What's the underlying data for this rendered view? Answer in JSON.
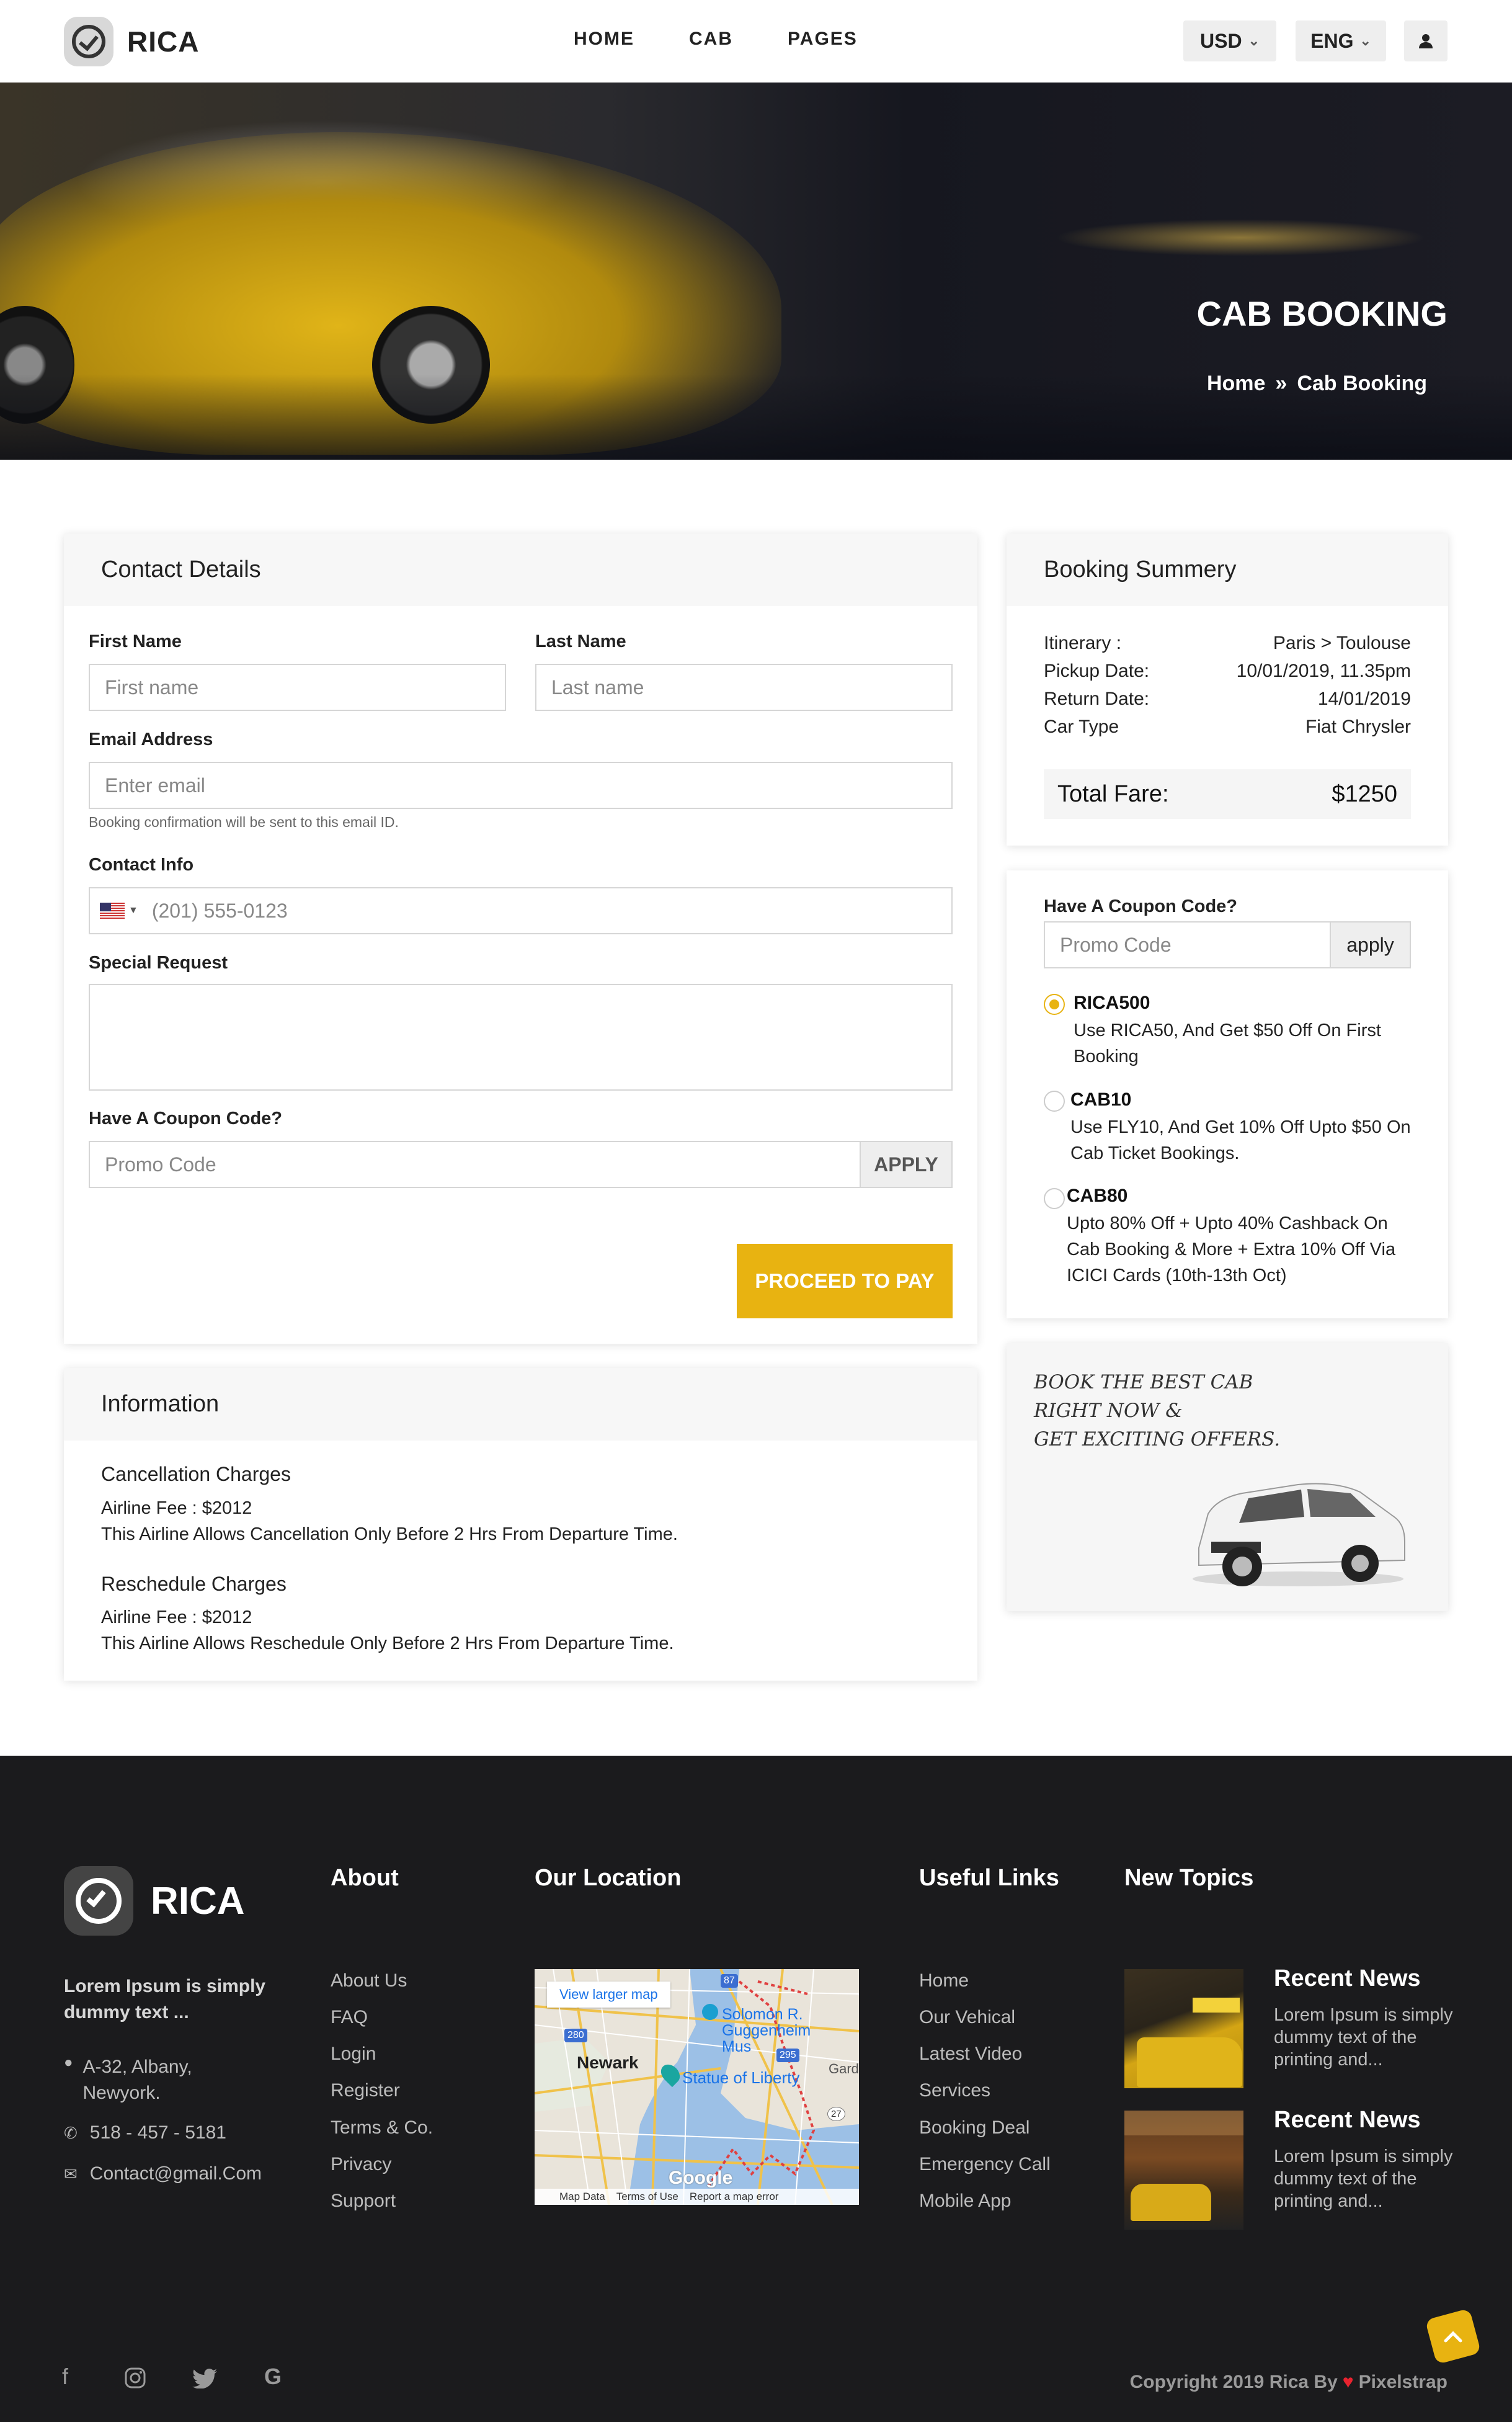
{
  "header": {
    "brand": "RICA",
    "nav": [
      "HOME",
      "CAB",
      "PAGES"
    ],
    "currency": "USD",
    "language": "ENG"
  },
  "hero": {
    "title": "CAB BOOKING",
    "breadcrumb_home": "Home",
    "breadcrumb_sep": "»",
    "breadcrumb_current": "Cab Booking"
  },
  "contact": {
    "title": "Contact Details",
    "first_name_label": "First Name",
    "first_name_placeholder": "First name",
    "last_name_label": "Last Name",
    "last_name_placeholder": "Last name",
    "email_label": "Email Address",
    "email_placeholder": "Enter email",
    "email_hint": "Booking confirmation will be sent to this email ID.",
    "contact_info_label": "Contact Info",
    "phone_placeholder": "(201) 555-0123",
    "special_request_label": "Special Request",
    "coupon_label": "Have A Coupon Code?",
    "coupon_placeholder": "Promo Code",
    "apply_label": "APPLY",
    "proceed_label": "PROCEED TO PAY"
  },
  "summary": {
    "title": "Booking Summery",
    "rows": [
      {
        "label": "Itinerary :",
        "value": "Paris > Toulouse"
      },
      {
        "label": "Pickup Date:",
        "value": "10/01/2019, 11.35pm"
      },
      {
        "label": "Return Date:",
        "value": "14/01/2019"
      },
      {
        "label": "Car Type",
        "value": "Fiat Chrysler"
      }
    ],
    "total_label": "Total Fare:",
    "total_value": "$1250"
  },
  "coupon_box": {
    "label": "Have A Coupon Code?",
    "placeholder": "Promo Code",
    "apply": "apply",
    "options": [
      {
        "code": "RICA500",
        "desc": "Use RICA50, And Get $50 Off On First Booking",
        "selected": true
      },
      {
        "code": "CAB10",
        "desc": "Use FLY10, And Get 10% Off Upto $50 On Cab Ticket Bookings.",
        "selected": false
      },
      {
        "code": "CAB80",
        "desc": "Upto 80% Off + Upto 40% Cashback On Cab Booking & More + Extra 10% Off Via ICICI Cards (10th-13th Oct)",
        "selected": false
      }
    ]
  },
  "promo": {
    "line1": "BOOK THE BEST CAB",
    "line2": "RIGHT NOW  &",
    "line3": "GET EXCITING OFFERS."
  },
  "information": {
    "title": "Information",
    "cancel_title": "Cancellation Charges",
    "cancel_fee": "Airline Fee : $2012",
    "cancel_text": "This Airline Allows Cancellation Only Before 2 Hrs From Departure Time.",
    "resched_title": "Reschedule Charges",
    "resched_fee": "Airline Fee : $2012",
    "resched_text": "This Airline Allows Reschedule Only Before 2 Hrs From Departure Time."
  },
  "footer": {
    "brand": "RICA",
    "tagline": "Lorem Ipsum is simply dummy text ...",
    "address": "A-32, Albany, Newyork.",
    "phone": "518 - 457 - 5181",
    "email": "Contact@gmail.Com",
    "about_title": "About",
    "about_links": [
      "About Us",
      "FAQ",
      "Login",
      "Register",
      "Terms & Co.",
      "Privacy",
      "Support"
    ],
    "location_title": "Our Location",
    "map": {
      "view_larger": "View larger map",
      "label_newark": "Newark",
      "label_solomon": "Solomon R. Guggenheim Mus",
      "label_statue": "Statue of Liberty",
      "label_garden": "Garden",
      "google": "Google",
      "map_data": "Map Data",
      "terms": "Terms of Use",
      "report": "Report a map error",
      "shield_280": "280",
      "shield_295": "295",
      "shield_87": "87",
      "shield_27": "27"
    },
    "useful_title": "Useful Links",
    "useful_links": [
      "Home",
      "Our Vehical",
      "Latest Video",
      "Services",
      "Booking Deal",
      "Emergency Call",
      "Mobile App"
    ],
    "topics_title": "New Topics",
    "news": [
      {
        "title": "Recent News",
        "text": "Lorem Ipsum is simply dummy text of the printing and..."
      },
      {
        "title": "Recent News",
        "text": "Lorem Ipsum is simply dummy text of the printing and..."
      }
    ],
    "copyright_prefix": "Copyright 2019 Rica By",
    "heart": "♥",
    "copyright_suffix": "Pixelstrap"
  }
}
